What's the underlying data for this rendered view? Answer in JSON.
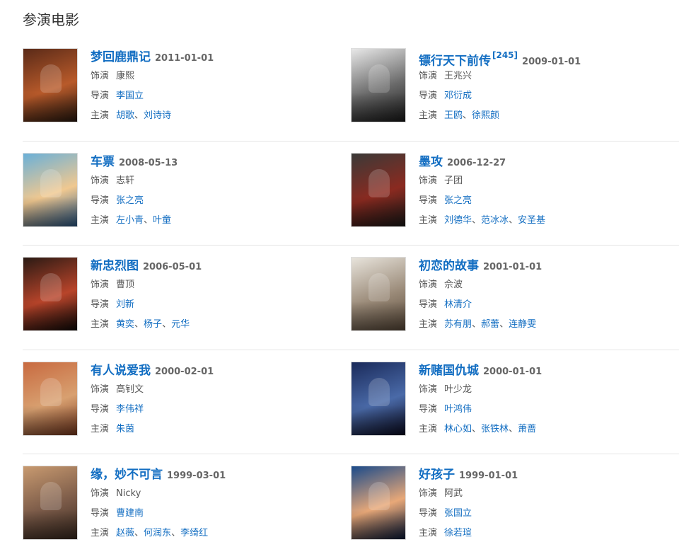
{
  "section_title": "参演电影",
  "films": [
    {
      "title": "梦回鹿鼎记",
      "citation": "",
      "date": "2011-01-01",
      "role_label": "饰演",
      "role": "康熙",
      "director_label": "导演",
      "director": "李国立",
      "cast_label": "主演",
      "cast": [
        "胡歌",
        "刘诗诗"
      ],
      "poster_colors": [
        "#5a2a18",
        "#b85a2a",
        "#2a1a10"
      ]
    },
    {
      "title": "镖行天下前传",
      "citation": "[245]",
      "date": "2009-01-01",
      "role_label": "饰演",
      "role": "王兆兴",
      "director_label": "导演",
      "director": "邓衍成",
      "cast_label": "主演",
      "cast": [
        "王鸥",
        "徐熙颜"
      ],
      "poster_colors": [
        "#e8e8e8",
        "#6a6a6a",
        "#1a1a1a"
      ]
    },
    {
      "title": "车票",
      "citation": "",
      "date": "2008-05-13",
      "role_label": "饰演",
      "role": "志轩",
      "director_label": "导演",
      "director": "张之亮",
      "cast_label": "主演",
      "cast": [
        "左小青",
        "叶童"
      ],
      "poster_colors": [
        "#6ab0d8",
        "#f0c890",
        "#2a5a8a"
      ]
    },
    {
      "title": "墨攻",
      "citation": "",
      "date": "2006-12-27",
      "role_label": "饰演",
      "role": "子团",
      "director_label": "导演",
      "director": "张之亮",
      "cast_label": "主演",
      "cast": [
        "刘德华",
        "范冰冰",
        "安圣基"
      ],
      "poster_colors": [
        "#3a3a38",
        "#8a2a20",
        "#1a1a18"
      ]
    },
    {
      "title": "新忠烈图",
      "citation": "",
      "date": "2006-05-01",
      "role_label": "饰演",
      "role": "曹顶",
      "director_label": "导演",
      "director": "刘新",
      "cast_label": "主演",
      "cast": [
        "黄奕",
        "杨子",
        "元华"
      ],
      "poster_colors": [
        "#2a1a14",
        "#b8442a",
        "#100a08"
      ]
    },
    {
      "title": "初恋的故事",
      "citation": "",
      "date": "2001-01-01",
      "role_label": "饰演",
      "role": "佘波",
      "director_label": "导演",
      "director": "林清介",
      "cast_label": "主演",
      "cast": [
        "苏有朋",
        "郝蕾",
        "连静雯"
      ],
      "poster_colors": [
        "#e8e4dc",
        "#9a8a78",
        "#5a4a3a"
      ]
    },
    {
      "title": "有人说爱我",
      "citation": "",
      "date": "2000-02-01",
      "role_label": "饰演",
      "role": "高钊文",
      "director_label": "导演",
      "director": "李伟祥",
      "cast_label": "主演",
      "cast": [
        "朱茵"
      ],
      "poster_colors": [
        "#c86a40",
        "#d8a070",
        "#7a3a20"
      ]
    },
    {
      "title": "新赌国仇城",
      "citation": "",
      "date": "2000-01-01",
      "role_label": "饰演",
      "role": "叶少龙",
      "director_label": "导演",
      "director": "叶鸿伟",
      "cast_label": "主演",
      "cast": [
        "林心如",
        "张铁林",
        "萧蔷"
      ],
      "poster_colors": [
        "#1a2a5a",
        "#4a6aa8",
        "#0a0a20"
      ]
    },
    {
      "title": "缘，妙不可言",
      "citation": "",
      "date": "1999-03-01",
      "role_label": "饰演",
      "role": "Nicky",
      "director_label": "导演",
      "director": "曹建南",
      "cast_label": "主演",
      "cast": [
        "赵薇",
        "何润东",
        "李绮红"
      ],
      "poster_colors": [
        "#c89a70",
        "#7a5a48",
        "#3a2a20"
      ]
    },
    {
      "title": "好孩子",
      "citation": "",
      "date": "1999-01-01",
      "role_label": "饰演",
      "role": "阿武",
      "director_label": "导演",
      "director": "张国立",
      "cast_label": "主演",
      "cast": [
        "徐若瑄"
      ],
      "poster_colors": [
        "#1a4a8a",
        "#e8a878",
        "#0a1a3a"
      ]
    }
  ]
}
